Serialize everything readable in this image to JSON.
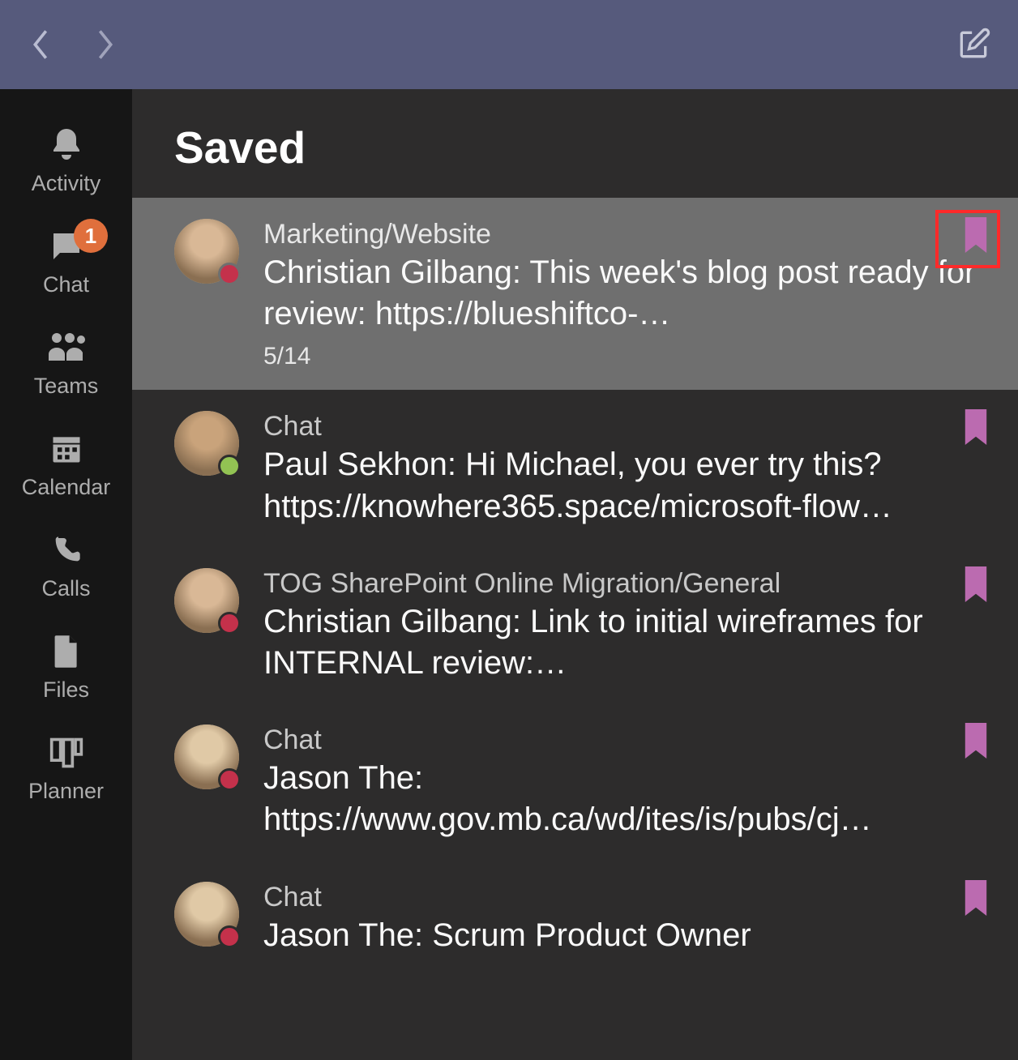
{
  "page_title": "Saved",
  "rail": {
    "activity": "Activity",
    "chat": "Chat",
    "chat_badge": "1",
    "teams": "Teams",
    "calendar": "Calendar",
    "calls": "Calls",
    "files": "Files",
    "planner": "Planner"
  },
  "items": [
    {
      "channel": "Marketing/Website",
      "message": "Christian Gilbang: This week's blog post ready for review: https://blueshiftco-…",
      "date": "5/14",
      "presence": "busy",
      "selected": true,
      "highlight": true
    },
    {
      "channel": "Chat",
      "message": "Paul Sekhon: Hi Michael, you ever try this? https://knowhere365.space/microsoft-flow…",
      "presence": "available"
    },
    {
      "channel": "TOG SharePoint Online Migration/General",
      "message": "Christian Gilbang: Link to initial wireframes for INTERNAL review:…",
      "presence": "busy"
    },
    {
      "channel": "Chat",
      "message": "Jason The: https://www.gov.mb.ca/wd/ites/is/pubs/cj…",
      "presence": "busy"
    },
    {
      "channel": "Chat",
      "message": "Jason The: Scrum Product Owner",
      "presence": "busy"
    }
  ]
}
